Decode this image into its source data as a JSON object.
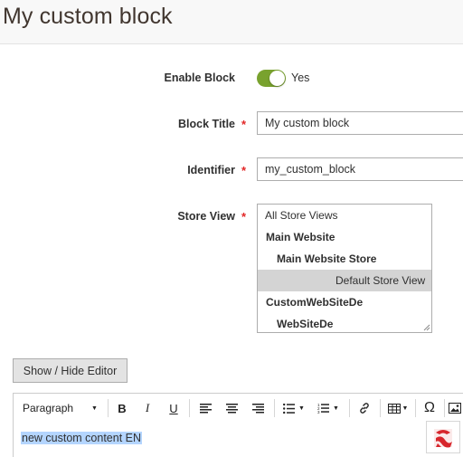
{
  "header": {
    "title": "My custom block"
  },
  "form": {
    "enable_block": {
      "label": "Enable Block",
      "value_text": "Yes",
      "enabled": true
    },
    "block_title": {
      "label": "Block Title",
      "required_mark": "*",
      "value": "My custom block"
    },
    "identifier": {
      "label": "Identifier",
      "required_mark": "*",
      "value": "my_custom_block"
    },
    "store_view": {
      "label": "Store View",
      "required_mark": "*",
      "options": [
        {
          "label": "All Store Views"
        },
        {
          "label": "Main Website"
        },
        {
          "label": "Main Website Store"
        },
        {
          "label": "Default Store View",
          "selected": true
        },
        {
          "label": "CustomWebSiteDe"
        },
        {
          "label": "WebSiteDe"
        }
      ]
    }
  },
  "editor": {
    "toggle_label": "Show / Hide Editor",
    "toolbar": {
      "format_select": "Paragraph",
      "bold": "B",
      "italic": "I",
      "underline": "U",
      "special_char": "Ω"
    },
    "content": "new custom content EN"
  },
  "colors": {
    "toggle_on": "#79a22e",
    "required": "#e22626",
    "selection": "#b4d5fe",
    "selected_option": "#d4d4d4"
  }
}
